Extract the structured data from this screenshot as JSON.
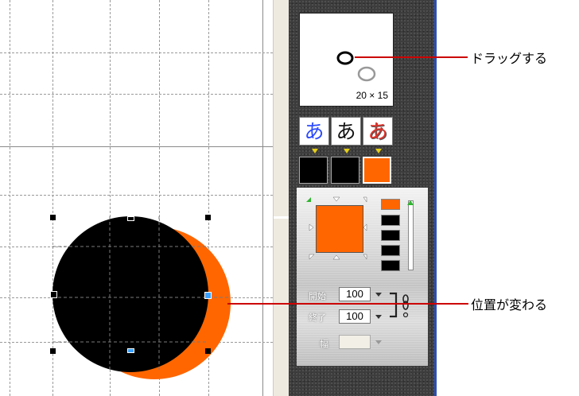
{
  "preview": {
    "size_label": "20 × 15"
  },
  "text_styles": [
    {
      "glyph": "あ",
      "name": "blue-text-style",
      "color": "#2a49ff"
    },
    {
      "glyph": "あ",
      "name": "plain-text-style",
      "color": "#111111"
    },
    {
      "glyph": "あ",
      "name": "red-shadow-text-style",
      "color": "#e0322a"
    }
  ],
  "swatches": {
    "first": "#000000",
    "second": "#000000",
    "third": "#ff6600"
  },
  "colors": {
    "accent": "#ff6600",
    "shape_fill": "#000000",
    "callout": "#cc0000"
  },
  "gradient": {
    "start_label": "開始",
    "start_value": "100",
    "end_label": "終了",
    "end_value": "100",
    "width_label": "幅",
    "width_value": ""
  },
  "callouts": {
    "drag": "ドラッグする",
    "position_changes": "位置が変わる"
  }
}
